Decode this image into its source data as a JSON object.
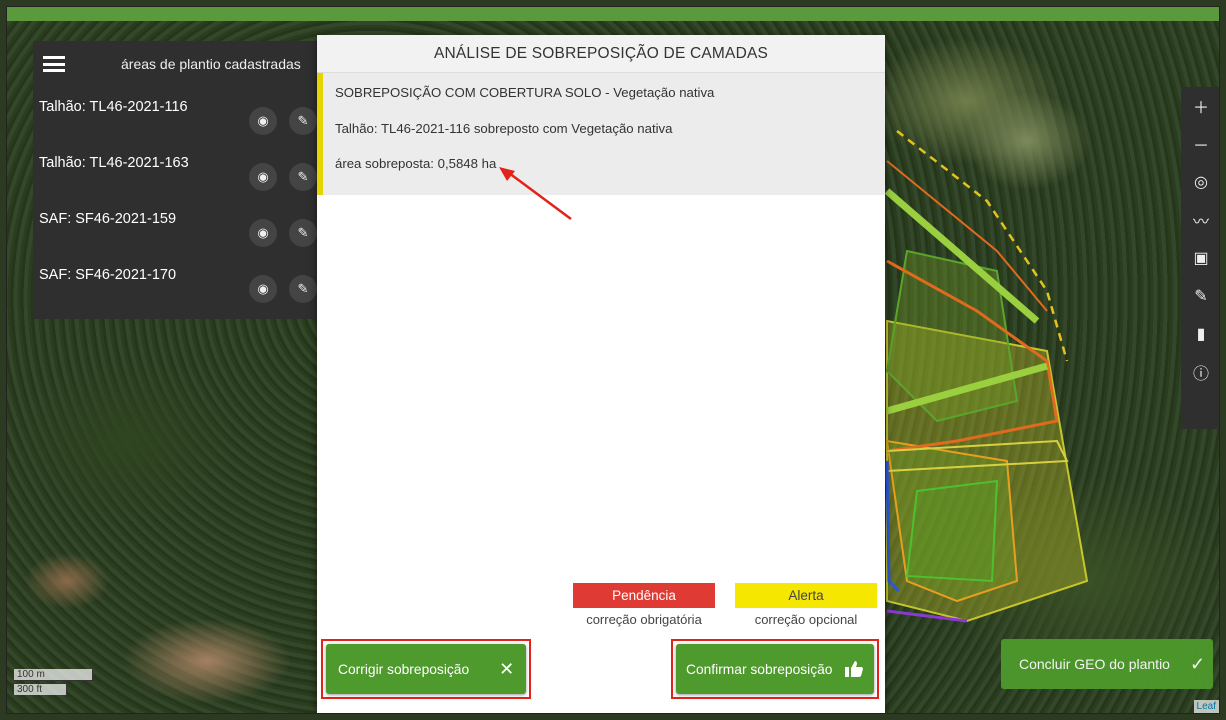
{
  "sidebar": {
    "title": "áreas de plantio cadastradas",
    "items": [
      {
        "label": "Talhão: TL46-2021-116"
      },
      {
        "label": "Talhão: TL46-2021-163"
      },
      {
        "label": "SAF: SF46-2021-159"
      },
      {
        "label": "SAF: SF46-2021-170"
      }
    ]
  },
  "modal": {
    "title": "ANÁLISE DE SOBREPOSIÇÃO DE CAMADAS",
    "alert": {
      "line1": "SOBREPOSIÇÃO COM COBERTURA SOLO - Vegetação nativa",
      "line2": "Talhão: TL46-2021-116 sobreposto com Vegetação nativa",
      "line3": "área sobreposta: 0,5848 ha"
    },
    "legend": {
      "pendencia": {
        "label": "Pendência",
        "desc": "correção obrigatória",
        "color": "#e03a34"
      },
      "alerta": {
        "label": "Alerta",
        "desc": "correção opcional",
        "color": "#f5e700"
      }
    },
    "buttons": {
      "corrigir": "Corrigir sobreposição",
      "confirmar": "Confirmar sobreposição"
    }
  },
  "toolbar": {
    "icons": [
      "plus-icon",
      "minus-icon",
      "locate-icon",
      "polyline-icon",
      "save-icon",
      "edit-icon",
      "trash-icon",
      "info-icon"
    ]
  },
  "concluir": {
    "label": "Concluir GEO do plantio"
  },
  "scale": {
    "m": "100 m",
    "ft": "300 ft"
  },
  "attribution": "Leaf",
  "colors": {
    "accent_green": "#4e9a2c",
    "highlight_red": "#e2231a",
    "alert_yellow": "#e6d400"
  }
}
